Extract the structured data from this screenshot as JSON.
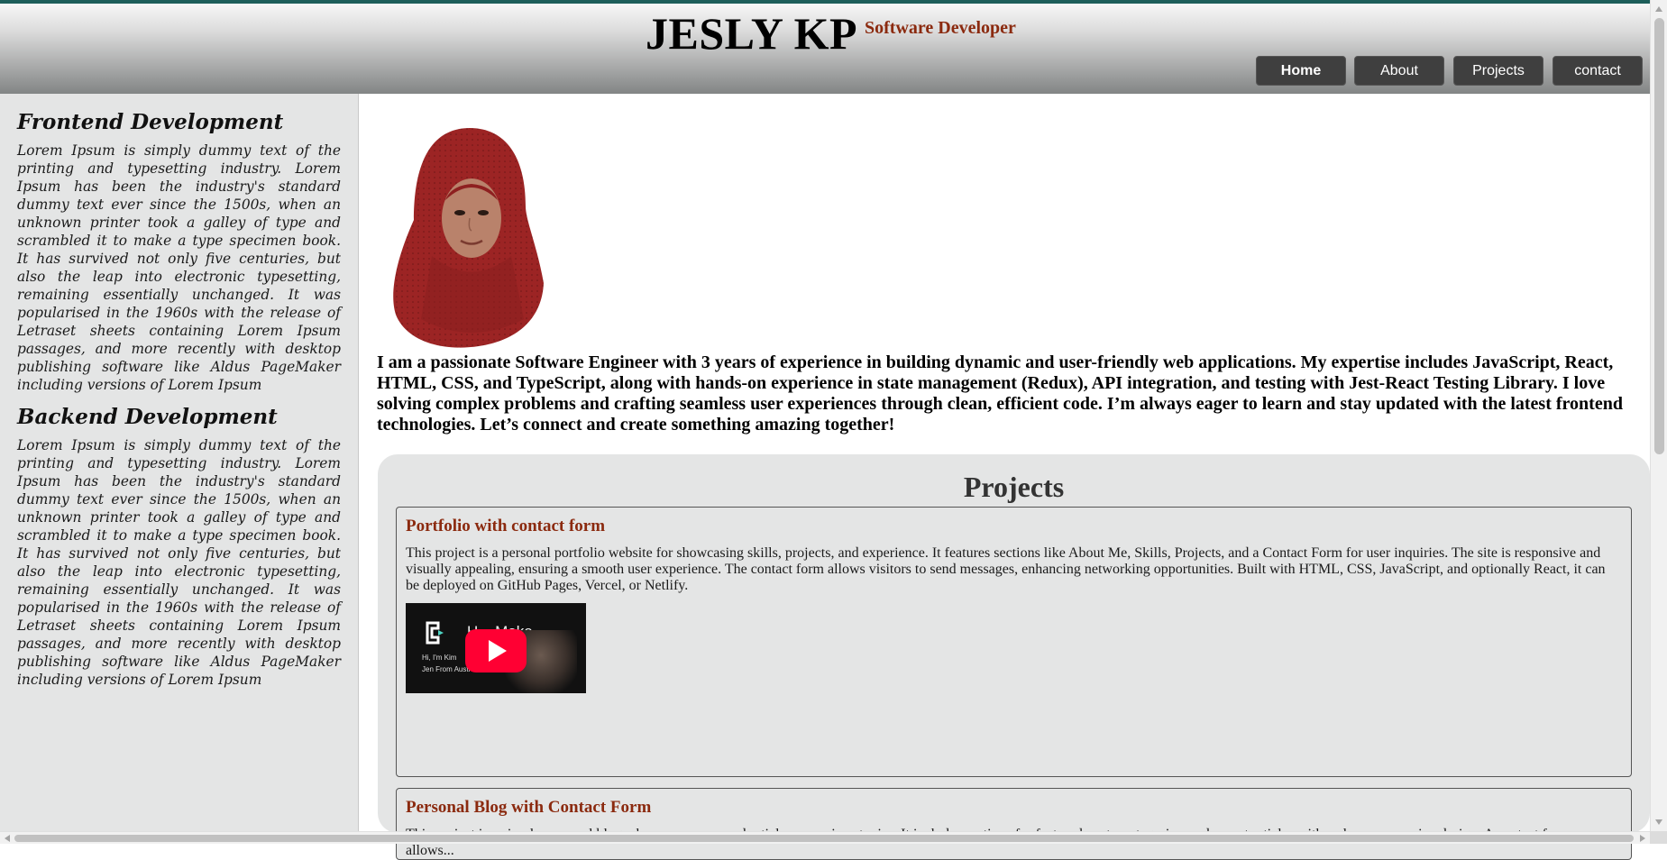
{
  "header": {
    "name": "JESLY KP",
    "subtitle": "Software Developer",
    "nav": [
      {
        "label": "Home",
        "active": true
      },
      {
        "label": "About",
        "active": false
      },
      {
        "label": "Projects",
        "active": false
      },
      {
        "label": "contact",
        "active": false
      }
    ]
  },
  "sidebar": {
    "sections": [
      {
        "title": "Frontend Development",
        "text": "Lorem Ipsum is simply dummy text of the printing and typesetting industry. Lorem Ipsum has been the industry's standard dummy text ever since the 1500s, when an unknown printer took a galley of type and scrambled it to make a type specimen book. It has survived not only five centuries, but also the leap into electronic typesetting, remaining essentially unchanged. It was popularised in the 1960s with the release of Letraset sheets containing Lorem Ipsum passages, and more recently with desktop publishing software like Aldus PageMaker including versions of Lorem Ipsum"
      },
      {
        "title": "Backend Development",
        "text": "Lorem Ipsum is simply dummy text of the printing and typesetting industry. Lorem Ipsum has been the industry's standard dummy text ever since the 1500s, when an unknown printer took a galley of type and scrambled it to make a type specimen book. It has survived not only five centuries, but also the leap into electronic typesetting, remaining essentially unchanged. It was popularised in the 1960s with the release of Letraset sheets containing Lorem Ipsum passages, and more recently with desktop publishing software like Aldus PageMaker including versions of Lorem Ipsum"
      }
    ]
  },
  "main": {
    "bio": "I am a passionate Software Engineer with 3 years of experience in building dynamic and user-friendly web applications. My expertise includes JavaScript, React, HTML, CSS, and TypeScript, along with hands-on experience in state management (Redux), API integration, and testing with Jest-React Testing Library. I love solving complex problems and crafting seamless user experiences through clean, efficient code. I’m always eager to learn and stay updated with the latest frontend technologies. Let’s connect and create something amazing together!",
    "projects": {
      "title": "Projects",
      "items": [
        {
          "title": "Portfolio with contact form",
          "description": "This project is a personal portfolio website for showcasing skills, projects, and experience. It features sections like About Me, Skills, Projects, and a Contact Form for user inquiries. The site is responsive and visually appealing, ensuring a smooth user experience. The contact form allows visitors to send messages, enhancing networking opportunities. Built with HTML, CSS, JavaScript, and optionally React, it can be deployed on GitHub Pages, Vercel, or Netlify.",
          "video": {
            "title": "H... Make ...",
            "caption_line1": "Hi, I'm Kim",
            "caption_line2": "Jen From Australia"
          }
        },
        {
          "title": "Personal Blog with Contact Form",
          "description": "This project is a simple personal blog where users can read articles on various topics. It includes sections for featured posts, categories, and recent articles with a clean, responsive design. A contact form allows..."
        }
      ]
    }
  },
  "icons": {
    "play": "play-icon",
    "video_logo": "video-logo-icon"
  },
  "colors": {
    "accent": "#8b2a0f",
    "top_border": "#1d5e5a",
    "nav_button": "#3f3f3f",
    "panel_bg": "#e4e5e5",
    "youtube_red": "#ff0033"
  }
}
